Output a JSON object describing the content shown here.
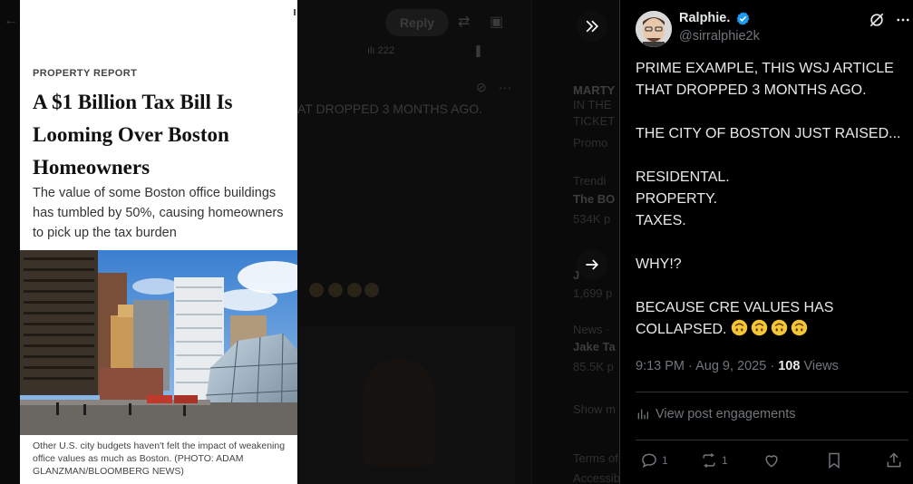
{
  "background": {
    "reply_label": "Reply",
    "view_count": "222",
    "mid_text": "AT DROPPED 3 MONTHS AGO.",
    "right_fragments": [
      {
        "text": "MARTY",
        "bold": true
      },
      {
        "text": "IN THE",
        "bold": false
      },
      {
        "text": "TICKET",
        "bold": false
      },
      {
        "text": "Promo",
        "bold": false
      },
      {
        "text": "Trendi",
        "bold": false
      },
      {
        "text": "The BO",
        "bold": true
      },
      {
        "text": "534K p",
        "bold": false
      },
      {
        "text": "J",
        "bold": true
      },
      {
        "text": "1,699 p",
        "bold": false
      },
      {
        "text": "News ·",
        "bold": false
      },
      {
        "text": "Jake Ta",
        "bold": true
      },
      {
        "text": "85.5K p",
        "bold": false
      },
      {
        "text": "Show m",
        "bold": false
      },
      {
        "text": "Terms of",
        "bold": false
      },
      {
        "text": "Accessib",
        "bold": false
      }
    ]
  },
  "article": {
    "kicker": "PROPERTY REPORT",
    "headline": "A $1 Billion Tax Bill Is Looming Over Boston Homeowners",
    "dek": "The value of some Boston office buildings has tumbled by 50%, causing homeowners to pick up the tax burden",
    "caption": "Other U.S. city budgets haven't felt the impact of weakening office values as much as Boston. (PHOTO: ADAM GLANZMAN/BLOOMBERG NEWS)"
  },
  "post": {
    "display_name": "Ralphie.",
    "handle": "@sirralphie2k",
    "text": "PRIME EXAMPLE, THIS WSJ ARTICLE THAT DROPPED 3 MONTHS AGO.\n\nTHE CITY OF BOSTON  JUST RAISED...\n\nRESIDENTAL.\nPROPERTY.\nTAXES.\n\nWHY!?\n\nBECAUSE CRE VALUES HAS COLLAPSED. ",
    "emoji_count": 4,
    "emoji_name": "upside-down-face",
    "time": "9:13 PM",
    "date": "Aug 9, 2025",
    "views_count": "108",
    "views_label": "Views",
    "engagements_label": "View post engagements",
    "reply_count": "1",
    "repost_count": "1",
    "like_count": "",
    "verified_color": "#1d9bf0"
  },
  "icons": {
    "collapse": "chevron-double-right-icon",
    "next": "arrow-right-icon",
    "grok": "grok-icon",
    "more": "more-icon"
  }
}
